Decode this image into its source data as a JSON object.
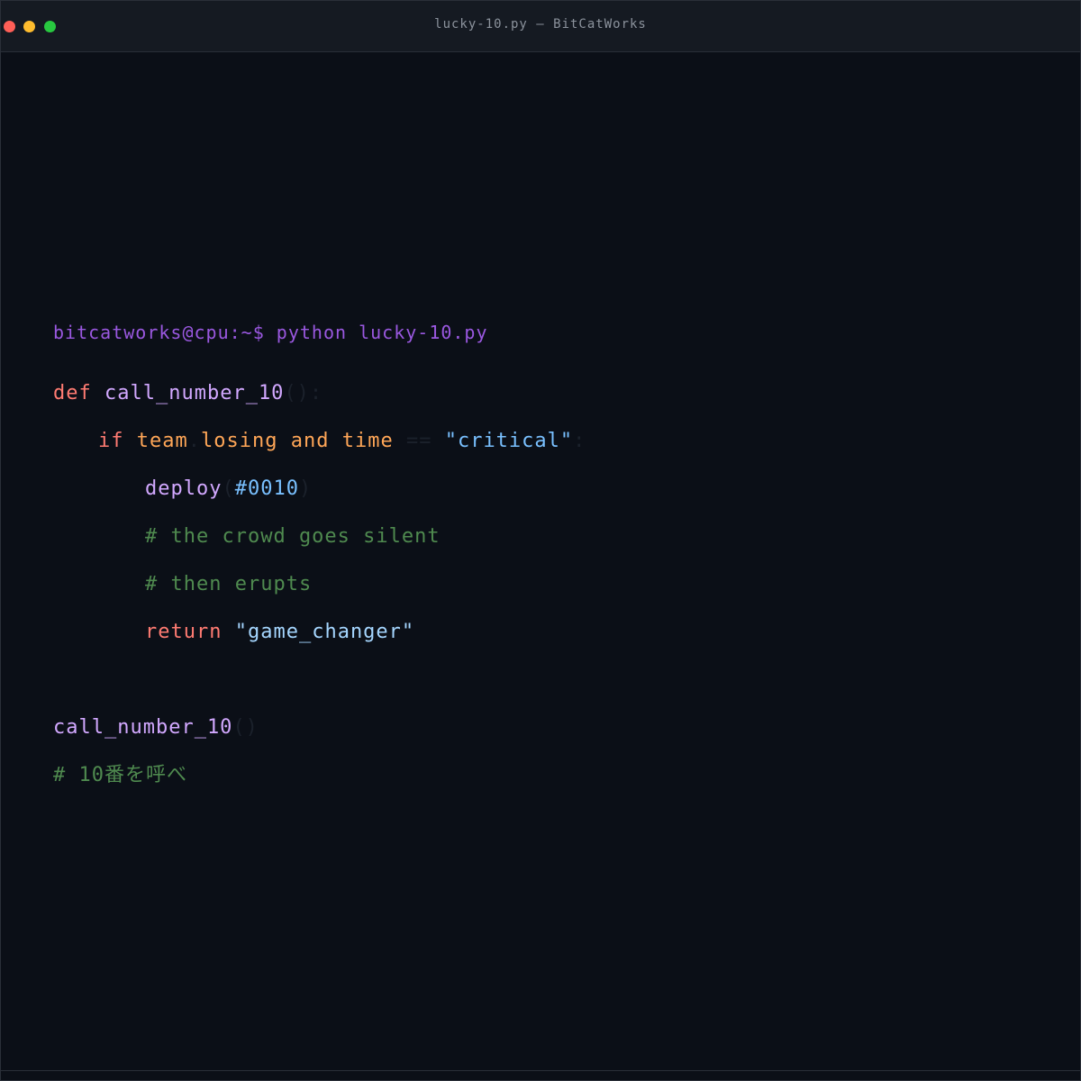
{
  "window": {
    "title": "lucky-10.py — BitCatWorks"
  },
  "terminal": {
    "prompt": "bitcatworks@cpu:~$ python lucky-10.py"
  },
  "code": {
    "line1": {
      "kw": "def",
      "fn": "call_number_10",
      "punc": "():"
    },
    "line2": {
      "kw_if": "if",
      "var_team": "team",
      "dot": ".",
      "var_losing": "losing",
      "kw_and": "and",
      "var_time": "time",
      "op": "==",
      "str": "\"critical\"",
      "colon": ":"
    },
    "line3": {
      "fn": "deploy",
      "open": "(",
      "arg": "#0010",
      "close": ")"
    },
    "line4": {
      "comment": "# the crowd goes silent"
    },
    "line5": {
      "comment": "# then erupts"
    },
    "line6": {
      "kw": "return",
      "str": "\"game_changer\""
    },
    "line7": {
      "fn": "call_number_10",
      "punc": "()"
    },
    "line8": {
      "comment": "# 10番を呼べ"
    }
  },
  "colors": {
    "background": "#0b0f17",
    "keyword": "#ff7b72",
    "function": "#d2a8ff",
    "variable": "#ffa657",
    "string": "#a5d6ff",
    "comment": "#4f8a4f",
    "prompt": "#9a58e0"
  }
}
